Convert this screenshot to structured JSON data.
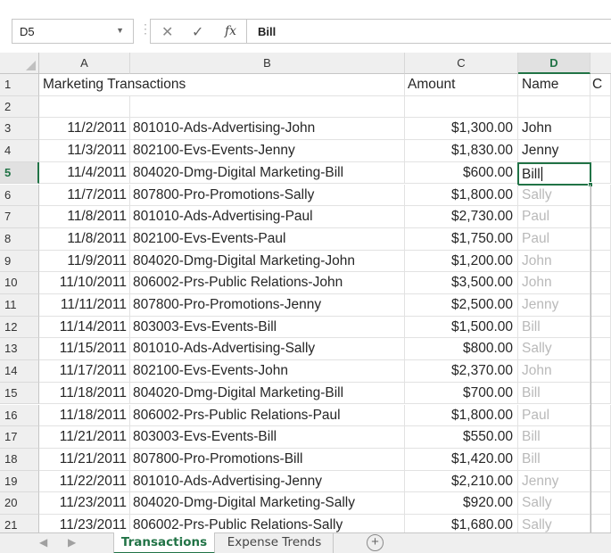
{
  "formula_bar": {
    "name_box": "D5",
    "name_box_arrow": "▼",
    "dots": "⋮",
    "cancel_glyph": "✕",
    "enter_glyph": "✓",
    "fx_glyph": "fx",
    "formula_value": "Bill"
  },
  "columns": [
    {
      "label": "A"
    },
    {
      "label": "B"
    },
    {
      "label": "C"
    },
    {
      "label": "D"
    }
  ],
  "row_numbers": [
    "1",
    "2",
    "3",
    "4",
    "5",
    "6",
    "7",
    "8",
    "9",
    "10",
    "11",
    "12",
    "13",
    "14",
    "15",
    "16",
    "17",
    "18",
    "19",
    "20",
    "21"
  ],
  "header_row": {
    "a": "Marketing Transactions",
    "c": "Amount",
    "d": "Name",
    "e": "C"
  },
  "rows": [
    {
      "date": "11/2/2011",
      "desc": "801010-Ads-Advertising-John",
      "amount": "$1,300.00",
      "name": "John"
    },
    {
      "date": "11/3/2011",
      "desc": "802100-Evs-Events-Jenny",
      "amount": "$1,830.00",
      "name": "Jenny"
    },
    {
      "date": "11/4/2011",
      "desc": "804020-Dmg-Digital Marketing-Bill",
      "amount": "$600.00",
      "name": "Bill"
    },
    {
      "date": "11/7/2011",
      "desc": "807800-Pro-Promotions-Sally",
      "amount": "$1,800.00",
      "name": "Sally"
    },
    {
      "date": "11/8/2011",
      "desc": "801010-Ads-Advertising-Paul",
      "amount": "$2,730.00",
      "name": "Paul"
    },
    {
      "date": "11/8/2011",
      "desc": "802100-Evs-Events-Paul",
      "amount": "$1,750.00",
      "name": "Paul"
    },
    {
      "date": "11/9/2011",
      "desc": "804020-Dmg-Digital Marketing-John",
      "amount": "$1,200.00",
      "name": "John"
    },
    {
      "date": "11/10/2011",
      "desc": "806002-Prs-Public Relations-John",
      "amount": "$3,500.00",
      "name": "John"
    },
    {
      "date": "11/11/2011",
      "desc": "807800-Pro-Promotions-Jenny",
      "amount": "$2,500.00",
      "name": "Jenny"
    },
    {
      "date": "11/14/2011",
      "desc": "803003-Evs-Events-Bill",
      "amount": "$1,500.00",
      "name": "Bill"
    },
    {
      "date": "11/15/2011",
      "desc": "801010-Ads-Advertising-Sally",
      "amount": "$800.00",
      "name": "Sally"
    },
    {
      "date": "11/17/2011",
      "desc": "802100-Evs-Events-John",
      "amount": "$2,370.00",
      "name": "John"
    },
    {
      "date": "11/18/2011",
      "desc": "804020-Dmg-Digital Marketing-Bill",
      "amount": "$700.00",
      "name": "Bill"
    },
    {
      "date": "11/18/2011",
      "desc": "806002-Prs-Public Relations-Paul",
      "amount": "$1,800.00",
      "name": "Paul"
    },
    {
      "date": "11/21/2011",
      "desc": "803003-Evs-Events-Bill",
      "amount": "$550.00",
      "name": "Bill"
    },
    {
      "date": "11/21/2011",
      "desc": "807800-Pro-Promotions-Bill",
      "amount": "$1,420.00",
      "name": "Bill"
    },
    {
      "date": "11/22/2011",
      "desc": "801010-Ads-Advertising-Jenny",
      "amount": "$2,210.00",
      "name": "Jenny"
    },
    {
      "date": "11/23/2011",
      "desc": "804020-Dmg-Digital Marketing-Sally",
      "amount": "$920.00",
      "name": "Sally"
    },
    {
      "date": "11/23/2011",
      "desc": "806002-Prs-Public Relations-Sally",
      "amount": "$1,680.00",
      "name": "Sally"
    }
  ],
  "active_cell": {
    "ref": "D5",
    "value": "Bill"
  },
  "sheet_tabs": {
    "nav_prev": "◀",
    "nav_next": "▶",
    "tabs": [
      {
        "label": "Transactions",
        "active": true
      },
      {
        "label": "Expense Trends",
        "active": false
      }
    ],
    "add_sheet": "+"
  },
  "colors": {
    "accent": "#217346",
    "ghost_text": "#b9b9b9",
    "header_bg": "#efefef"
  }
}
